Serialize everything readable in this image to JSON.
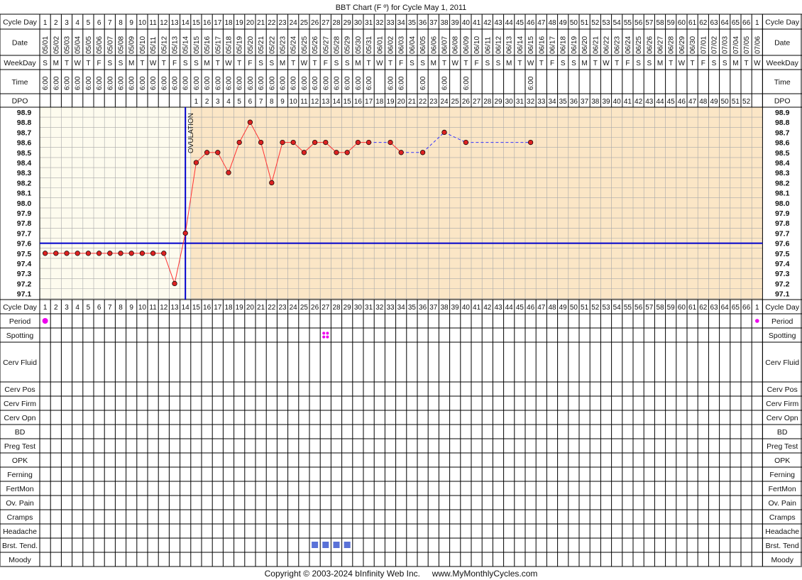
{
  "title": "BBT Chart (F º) for Cycle May 1, 2011",
  "footer": "Copyright © 2003-2024 bInfinity Web Inc.     www.MyMonthlyCycles.com",
  "row_labels": {
    "cycle_day": "Cycle Day",
    "date": "Date",
    "weekday": "WeekDay",
    "time": "Time",
    "dpo": "DPO",
    "ovulation": "OVULATION"
  },
  "symptom_rows": [
    "Period",
    "Spotting",
    "Cerv Fluid",
    "Cerv Pos",
    "Cerv Firm",
    "Cerv Opn",
    "BD",
    "Preg Test",
    "OPK",
    "Ferning",
    "FertMon",
    "Ov. Pain",
    "Cramps",
    "Headache",
    "Brst. Tend.",
    "Moody"
  ],
  "symptom_rows_right": [
    "Period",
    "Spotting",
    "Cerv Fluid",
    "Cerv Pos",
    "Cerv Firm",
    "Cerv Opn",
    "BD",
    "Preg Test",
    "OPK",
    "Ferning",
    "FertMon",
    "Ov. Pain",
    "Cramps",
    "Headache",
    "Brst. Tend",
    "Moody"
  ],
  "colors": {
    "follicular_bg": "#fdfbee",
    "luteal_bg": "#fbe6c6",
    "grid": "#a8a8a8",
    "coverline": "#0000cc",
    "ovulation_line": "#0000cc",
    "temp_line": "#ff3333",
    "temp_point": "#dd2222",
    "projected_line": "#3333ff",
    "period_marker": "#ee00ee",
    "spotting_marker": "#ee00ee",
    "breast_tenderness_marker": "#5a72d8"
  },
  "chart_data": {
    "type": "line",
    "title": "BBT Chart (F º) for Cycle May 1, 2011",
    "y_ticks": [
      "98.9",
      "98.8",
      "98.7",
      "98.6",
      "98.5",
      "98.4",
      "98.3",
      "98.2",
      "98.1",
      "98.0",
      "97.9",
      "97.8",
      "97.7",
      "97.6",
      "97.5",
      "97.4",
      "97.3",
      "97.2",
      "97.1"
    ],
    "ylim": [
      97.1,
      98.9
    ],
    "cycle_days": [
      "1",
      "2",
      "3",
      "4",
      "5",
      "6",
      "7",
      "8",
      "9",
      "10",
      "11",
      "12",
      "13",
      "14",
      "15",
      "16",
      "17",
      "18",
      "19",
      "20",
      "21",
      "22",
      "23",
      "24",
      "25",
      "26",
      "27",
      "28",
      "29",
      "30",
      "31",
      "32",
      "33",
      "34",
      "35",
      "36",
      "37",
      "38",
      "39",
      "40",
      "41",
      "42",
      "43",
      "44",
      "45",
      "46",
      "47",
      "48",
      "49",
      "50",
      "51",
      "52",
      "53",
      "54",
      "55",
      "56",
      "57",
      "58",
      "59",
      "60",
      "61",
      "62",
      "63",
      "64",
      "65",
      "66",
      "1"
    ],
    "dates": [
      "05/01",
      "05/02",
      "05/03",
      "05/04",
      "05/05",
      "05/06",
      "05/07",
      "05/08",
      "05/09",
      "05/10",
      "05/11",
      "05/12",
      "05/13",
      "05/14",
      "05/15",
      "05/16",
      "05/17",
      "05/18",
      "05/19",
      "05/20",
      "05/21",
      "05/22",
      "05/23",
      "05/24",
      "05/25",
      "05/26",
      "05/27",
      "05/28",
      "05/29",
      "05/30",
      "05/31",
      "06/01",
      "06/02",
      "06/03",
      "06/04",
      "06/05",
      "06/06",
      "06/07",
      "06/08",
      "06/09",
      "06/10",
      "06/11",
      "06/12",
      "06/13",
      "06/14",
      "06/15",
      "06/16",
      "06/17",
      "06/18",
      "06/19",
      "06/20",
      "06/21",
      "06/22",
      "06/23",
      "06/24",
      "06/25",
      "06/26",
      "06/27",
      "06/28",
      "06/29",
      "06/30",
      "07/01",
      "07/02",
      "07/03",
      "07/04",
      "07/05",
      "07/06"
    ],
    "weekdays": [
      "S",
      "M",
      "T",
      "W",
      "T",
      "F",
      "S",
      "S",
      "M",
      "T",
      "W",
      "T",
      "F",
      "S",
      "S",
      "M",
      "T",
      "W",
      "T",
      "F",
      "S",
      "S",
      "M",
      "T",
      "W",
      "T",
      "F",
      "S",
      "S",
      "M",
      "T",
      "W",
      "T",
      "F",
      "S",
      "S",
      "M",
      "T",
      "W",
      "T",
      "F",
      "S",
      "S",
      "M",
      "T",
      "W",
      "T",
      "F",
      "S",
      "S",
      "M",
      "T",
      "W",
      "T",
      "F",
      "S",
      "S",
      "M",
      "T",
      "W",
      "T",
      "F",
      "S",
      "S",
      "M",
      "T",
      "W"
    ],
    "times": [
      "6:00",
      "6:00",
      "6:00",
      "6:00",
      "6:00",
      "6:00",
      "6:00",
      "6:00",
      "6:00",
      "6:00",
      "6:00",
      "6:00",
      "6:00",
      "6:00",
      "6:00",
      "6:00",
      "6:00",
      "6:00",
      "6:00",
      "6:00",
      "6:00",
      "6:00",
      "6:00",
      "6:00",
      "6:00",
      "6:00",
      "6:00",
      "6:00",
      "6:00",
      "6:00",
      "6:00",
      "",
      "6:00",
      "6:00",
      "",
      "6:00",
      "",
      "6:00",
      "",
      "6:00",
      "",
      "",
      "",
      "",
      "",
      "6:00",
      "",
      "",
      "",
      "",
      "",
      "",
      "",
      "",
      "",
      "",
      "",
      "",
      "",
      "",
      "",
      "",
      "",
      "",
      "",
      "",
      ""
    ],
    "dpo": [
      "",
      "",
      "",
      "",
      "",
      "",
      "",
      "",
      "",
      "",
      "",
      "",
      "",
      "",
      "1",
      "2",
      "3",
      "4",
      "5",
      "6",
      "7",
      "8",
      "9",
      "10",
      "11",
      "12",
      "13",
      "14",
      "15",
      "16",
      "17",
      "18",
      "19",
      "20",
      "21",
      "22",
      "23",
      "24",
      "25",
      "26",
      "27",
      "28",
      "29",
      "30",
      "31",
      "32",
      "33",
      "34",
      "35",
      "36",
      "37",
      "38",
      "39",
      "40",
      "41",
      "42",
      "43",
      "44",
      "45",
      "46",
      "47",
      "48",
      "49",
      "50",
      "51",
      "52",
      ""
    ],
    "temps": [
      97.5,
      97.5,
      97.5,
      97.5,
      97.5,
      97.5,
      97.5,
      97.5,
      97.5,
      97.5,
      97.5,
      97.5,
      97.2,
      97.7,
      98.4,
      98.5,
      98.5,
      98.3,
      98.6,
      98.8,
      98.6,
      98.2,
      98.6,
      98.6,
      98.5,
      98.6,
      98.6,
      98.5,
      98.5,
      98.6,
      98.6,
      null,
      98.6,
      98.5,
      null,
      98.5,
      null,
      98.7,
      null,
      98.6,
      null,
      null,
      null,
      null,
      null,
      98.6,
      null,
      null,
      null,
      null,
      null,
      null,
      null,
      null,
      null,
      null,
      null,
      null,
      null,
      null,
      null,
      null,
      null,
      null,
      null,
      null,
      null
    ],
    "coverline": 97.6,
    "ovulation_day": 14,
    "period_days": [
      1,
      67
    ],
    "spotting_days": [
      27
    ],
    "breast_tenderness_days": [
      26,
      27,
      28,
      29
    ]
  }
}
